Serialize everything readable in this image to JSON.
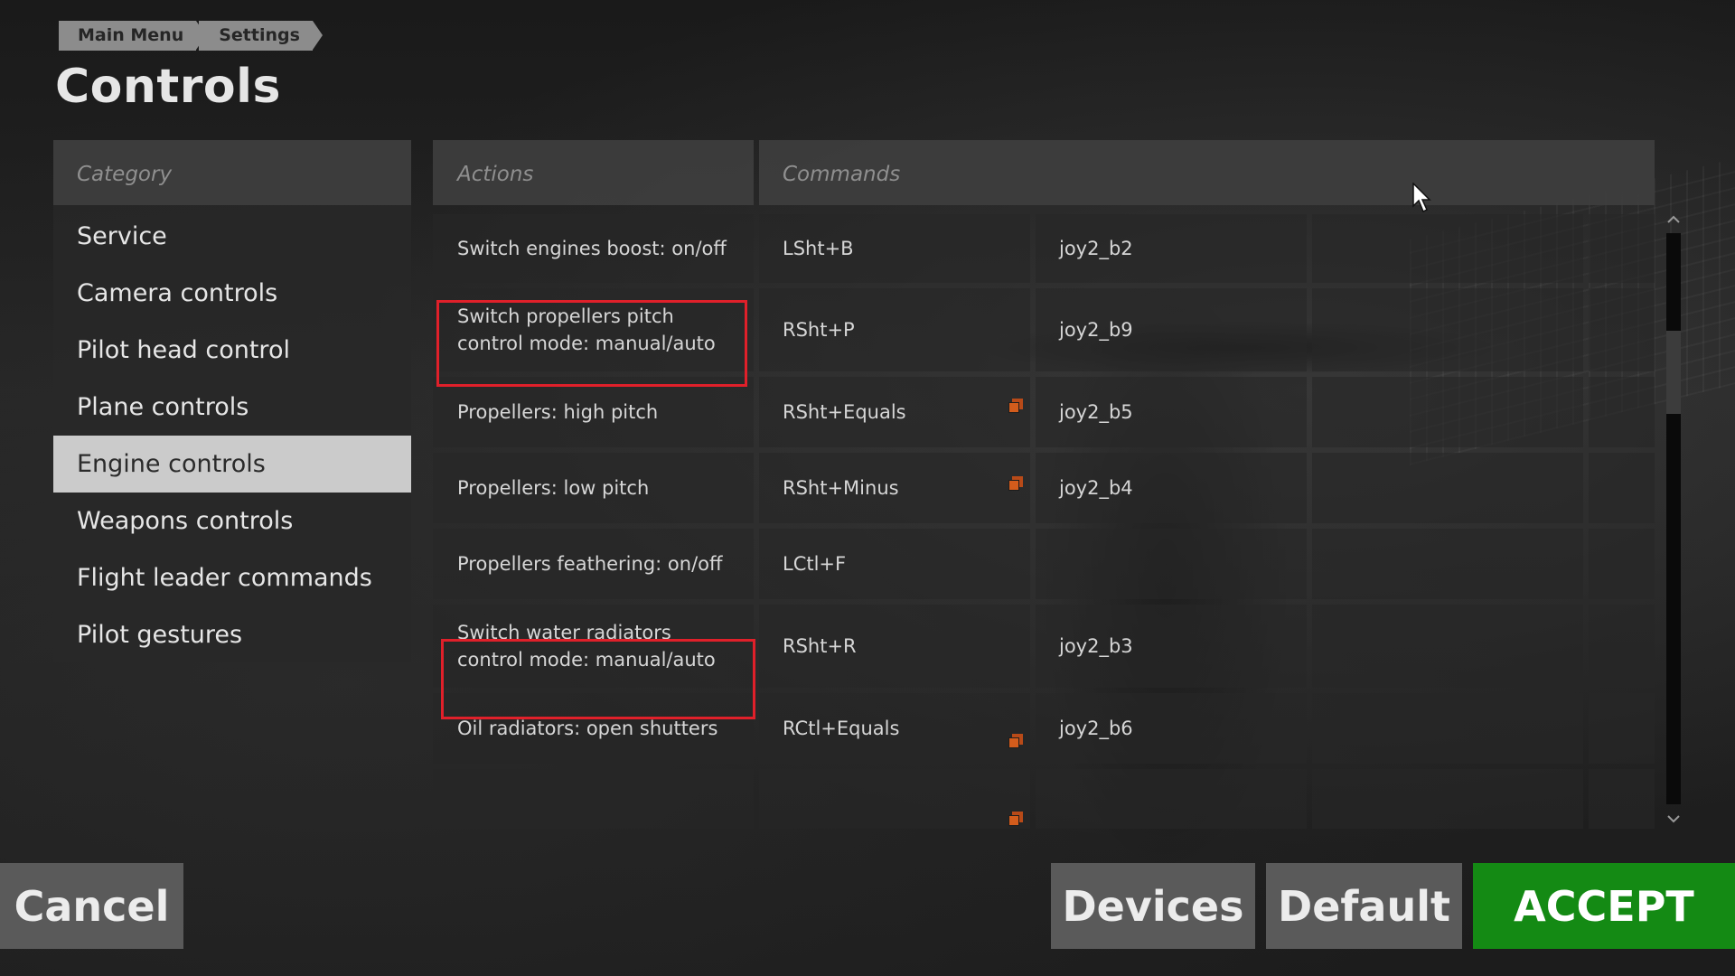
{
  "breadcrumb": [
    "Main Menu",
    "Settings"
  ],
  "title": "Controls",
  "category": {
    "header": "Category",
    "items": [
      "Service",
      "Camera controls",
      "Pilot head control",
      "Plane controls",
      "Engine controls",
      "Weapons controls",
      "Flight leader commands",
      "Pilot gestures"
    ],
    "selected": "Engine controls"
  },
  "table": {
    "actions_header": "Actions",
    "commands_header": "Commands",
    "rows": [
      {
        "action": "Switch engines boost: on/off",
        "key": "LSht+B",
        "joy": "joy2_b2"
      },
      {
        "action": "Switch propellers pitch control mode: manual/auto",
        "key": "RSht+P",
        "joy": "joy2_b9",
        "highlighted": true
      },
      {
        "action": "Propellers: high pitch",
        "key": "RSht+Equals",
        "joy": "joy2_b5",
        "modifier_icon": true
      },
      {
        "action": "Propellers: low pitch",
        "key": "RSht+Minus",
        "joy": "joy2_b4",
        "modifier_icon": true
      },
      {
        "action": "Propellers feathering: on/off",
        "key": "LCtl+F",
        "joy": ""
      },
      {
        "action": "Switch water radiators control mode: manual/auto",
        "key": "RSht+R",
        "joy": "joy2_b3",
        "highlighted": true
      },
      {
        "action": "Oil radiators: open shutters",
        "key": "RCtl+Equals",
        "joy": "joy2_b6",
        "modifier_icon": true
      },
      {
        "action": "",
        "key": "",
        "joy": "",
        "modifier_icon": true
      }
    ]
  },
  "scrollbar": {
    "up_icon": "chevron-up-icon",
    "down_icon": "chevron-down-icon"
  },
  "buttons": {
    "cancel": "Cancel",
    "devices": "Devices",
    "default": "Default",
    "accept": "ACCEPT"
  },
  "colors": {
    "highlight": "#e0202a",
    "accept": "#148a14",
    "modifier": "#d35c1c",
    "selected_category": "#cbcbcb"
  }
}
